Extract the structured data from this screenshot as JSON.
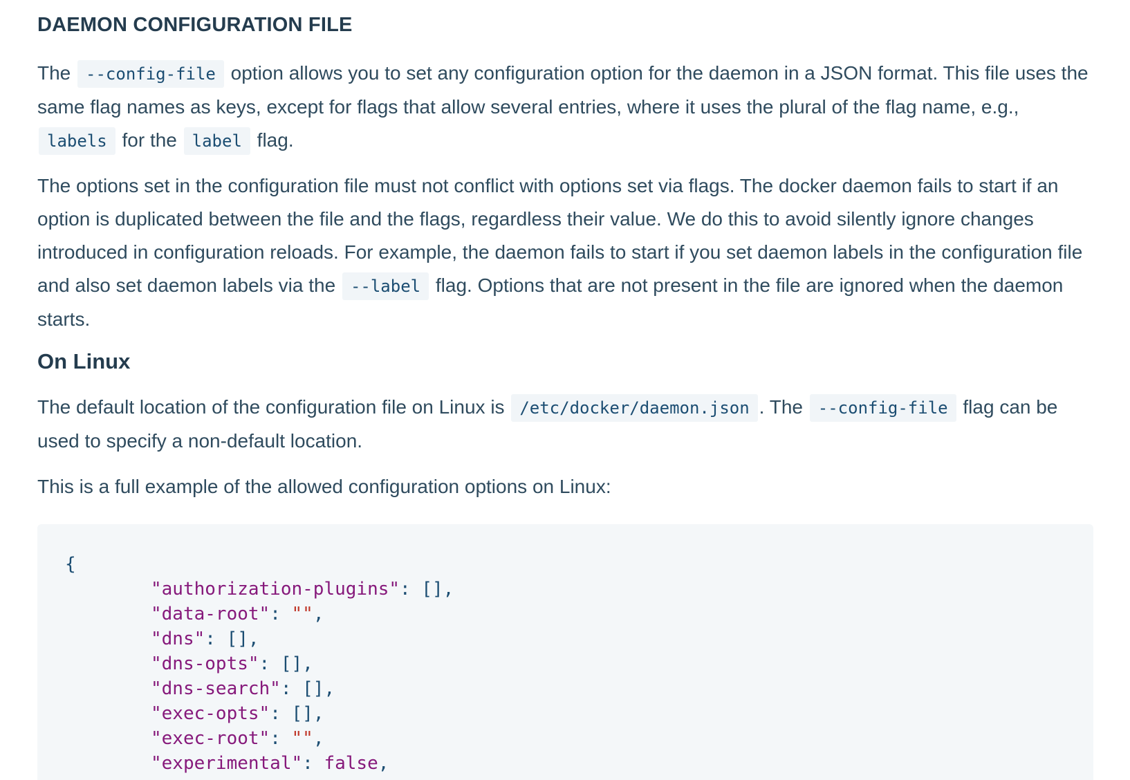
{
  "section_title": "DAEMON CONFIGURATION FILE",
  "para1": {
    "t1": "The ",
    "code1": "--config-file",
    "t2": " option allows you to set any configuration option for the daemon in a JSON format. This file uses the same flag names as keys, except for flags that allow several entries, where it uses the plural of the flag name, e.g., ",
    "code2": "labels",
    "t3": " for the ",
    "code3": "label",
    "t4": " flag."
  },
  "para2": {
    "t1": "The options set in the configuration file must not conflict with options set via flags. The docker daemon fails to start if an option is duplicated between the file and the flags, regardless their value. We do this to avoid silently ignore changes introduced in configuration reloads. For example, the daemon fails to start if you set daemon labels in the configuration file and also set daemon labels via the ",
    "code1": "--label",
    "t2": " flag. Options that are not present in the file are ignored when the daemon starts."
  },
  "subsection_title": "On Linux",
  "para3": {
    "t1": "The default location of the configuration file on Linux is ",
    "code1": "/etc/docker/daemon.json",
    "t2": ". The ",
    "code2": "--config-file",
    "t3": " flag can be used to specify a non-default location."
  },
  "para4": "This is a full example of the allowed configuration options on Linux:",
  "code_block": {
    "open_brace": "{",
    "lines": [
      {
        "key": "\"authorization-plugins\"",
        "sep": ": ",
        "value": "[]",
        "value_type": "punct",
        "end": ","
      },
      {
        "key": "\"data-root\"",
        "sep": ": ",
        "value": "\"\"",
        "value_type": "str",
        "end": ","
      },
      {
        "key": "\"dns\"",
        "sep": ": ",
        "value": "[]",
        "value_type": "punct",
        "end": ","
      },
      {
        "key": "\"dns-opts\"",
        "sep": ": ",
        "value": "[]",
        "value_type": "punct",
        "end": ","
      },
      {
        "key": "\"dns-search\"",
        "sep": ": ",
        "value": "[]",
        "value_type": "punct",
        "end": ","
      },
      {
        "key": "\"exec-opts\"",
        "sep": ": ",
        "value": "[]",
        "value_type": "punct",
        "end": ","
      },
      {
        "key": "\"exec-root\"",
        "sep": ": ",
        "value": "\"\"",
        "value_type": "str",
        "end": ","
      },
      {
        "key": "\"experimental\"",
        "sep": ": ",
        "value": "false",
        "value_type": "bool",
        "end": ","
      }
    ]
  }
}
